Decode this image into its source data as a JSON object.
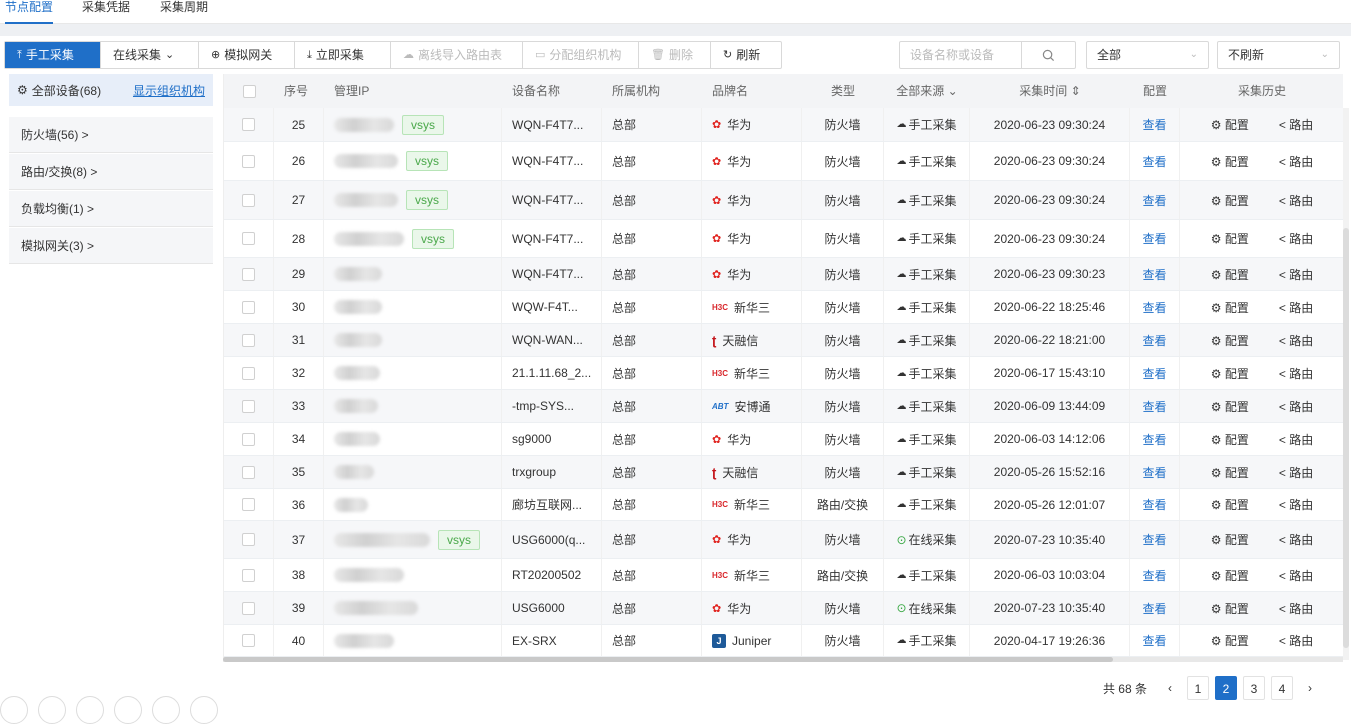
{
  "tabs": [
    "节点配置",
    "采集凭据",
    "采集周期"
  ],
  "toolbar": {
    "manual": "手工采集",
    "online": "在线采集",
    "simulate": "模拟网关",
    "collect_now": "立即采集",
    "offline_import": "离线导入路由表",
    "assign_org": "分配组织机构",
    "delete": "删除",
    "refresh": "刷新"
  },
  "search": {
    "placeholder": "设备名称或设备"
  },
  "filter_source": "全部",
  "filter_refresh": "不刷新",
  "sidebar": {
    "all_label": "全部设备(68)",
    "org_link": "显示组织机构",
    "items": [
      "防火墙(56) >",
      "路由/交换(8) >",
      "负载均衡(1) >",
      "模拟网关(3) >"
    ]
  },
  "table": {
    "headers": {
      "no": "序号",
      "ip": "管理IP",
      "name": "设备名称",
      "org": "所属机构",
      "brand": "品牌名",
      "type": "类型",
      "source": "全部来源",
      "time": "采集时间",
      "config": "配置",
      "history": "采集历史"
    },
    "rows": [
      {
        "no": "25",
        "ip_w": 60,
        "vsys": "vsys",
        "name": "WQN-F4T7...",
        "org": "总部",
        "brand": "华为",
        "brand_kind": "huawei",
        "type": "防火墙",
        "source": "手工采集",
        "online": false,
        "time": "2020-06-23 09:30:24"
      },
      {
        "no": "26",
        "ip_w": 64,
        "vsys": "vsys",
        "name": "WQN-F4T7...",
        "org": "总部",
        "brand": "华为",
        "brand_kind": "huawei",
        "type": "防火墙",
        "source": "手工采集",
        "online": false,
        "time": "2020-06-23 09:30:24"
      },
      {
        "no": "27",
        "ip_w": 64,
        "vsys": "vsys",
        "name": "WQN-F4T7...",
        "org": "总部",
        "brand": "华为",
        "brand_kind": "huawei",
        "type": "防火墙",
        "source": "手工采集",
        "online": false,
        "time": "2020-06-23 09:30:24"
      },
      {
        "no": "28",
        "ip_w": 70,
        "vsys": "vsys",
        "name": "WQN-F4T7...",
        "org": "总部",
        "brand": "华为",
        "brand_kind": "huawei",
        "type": "防火墙",
        "source": "手工采集",
        "online": false,
        "time": "2020-06-23 09:30:24"
      },
      {
        "no": "29",
        "ip_w": 48,
        "vsys": "",
        "name": "WQN-F4T7...",
        "org": "总部",
        "brand": "华为",
        "brand_kind": "huawei",
        "type": "防火墙",
        "source": "手工采集",
        "online": false,
        "time": "2020-06-23 09:30:23"
      },
      {
        "no": "30",
        "ip_w": 48,
        "vsys": "",
        "name": "WQW-F4T...",
        "org": "总部",
        "brand": "新华三",
        "brand_kind": "h3c",
        "type": "防火墙",
        "source": "手工采集",
        "online": false,
        "time": "2020-06-22 18:25:46"
      },
      {
        "no": "31",
        "ip_w": 48,
        "vsys": "",
        "name": "WQN-WAN...",
        "org": "总部",
        "brand": "天融信",
        "brand_kind": "topsec",
        "type": "防火墙",
        "source": "手工采集",
        "online": false,
        "time": "2020-06-22 18:21:00"
      },
      {
        "no": "32",
        "ip_w": 46,
        "vsys": "",
        "name": "21.1.11.68_2...",
        "org": "总部",
        "brand": "新华三",
        "brand_kind": "h3c",
        "type": "防火墙",
        "source": "手工采集",
        "online": false,
        "time": "2020-06-17 15:43:10"
      },
      {
        "no": "33",
        "ip_w": 44,
        "vsys": "",
        "name": "-tmp-SYS...",
        "org": "总部",
        "brand": "安博通",
        "brand_kind": "abt",
        "type": "防火墙",
        "source": "手工采集",
        "online": false,
        "time": "2020-06-09 13:44:09"
      },
      {
        "no": "34",
        "ip_w": 46,
        "vsys": "",
        "name": "sg9000",
        "org": "总部",
        "brand": "华为",
        "brand_kind": "huawei",
        "type": "防火墙",
        "source": "手工采集",
        "online": false,
        "time": "2020-06-03 14:12:06"
      },
      {
        "no": "35",
        "ip_w": 40,
        "vsys": "",
        "name": "trxgroup",
        "org": "总部",
        "brand": "天融信",
        "brand_kind": "topsec",
        "type": "防火墙",
        "source": "手工采集",
        "online": false,
        "time": "2020-05-26 15:52:16"
      },
      {
        "no": "36",
        "ip_w": 34,
        "vsys": "",
        "name": "廊坊互联网...",
        "org": "总部",
        "brand": "新华三",
        "brand_kind": "h3c",
        "type": "路由/交换",
        "source": "手工采集",
        "online": false,
        "time": "2020-05-26 12:01:07"
      },
      {
        "no": "37",
        "ip_w": 96,
        "vsys": "vsys",
        "name": "USG6000(q...",
        "org": "总部",
        "brand": "华为",
        "brand_kind": "huawei",
        "type": "防火墙",
        "source": "在线采集",
        "online": true,
        "time": "2020-07-23 10:35:40"
      },
      {
        "no": "38",
        "ip_w": 70,
        "vsys": "",
        "name": "RT20200502",
        "org": "总部",
        "brand": "新华三",
        "brand_kind": "h3c",
        "type": "路由/交换",
        "source": "手工采集",
        "online": false,
        "time": "2020-06-03 10:03:04"
      },
      {
        "no": "39",
        "ip_w": 84,
        "vsys": "",
        "name": "USG6000",
        "org": "总部",
        "brand": "华为",
        "brand_kind": "huawei",
        "type": "防火墙",
        "source": "在线采集",
        "online": true,
        "time": "2020-07-23 10:35:40"
      },
      {
        "no": "40",
        "ip_w": 60,
        "vsys": "",
        "name": "EX-SRX",
        "org": "总部",
        "brand": "Juniper",
        "brand_kind": "juniper",
        "type": "防火墙",
        "source": "手工采集",
        "online": false,
        "time": "2020-04-17 19:26:36"
      }
    ],
    "view_label": "查看",
    "config_label": "配置",
    "route_label": "路由"
  },
  "pagination": {
    "total": "共 68 条",
    "pages": [
      "1",
      "2",
      "3",
      "4"
    ],
    "current": "2"
  },
  "colors": {
    "primary": "#1f6fc8",
    "vsys_green": "#4aa84a",
    "huawei_red": "#e0201c",
    "h3c_red": "#d8262b"
  }
}
